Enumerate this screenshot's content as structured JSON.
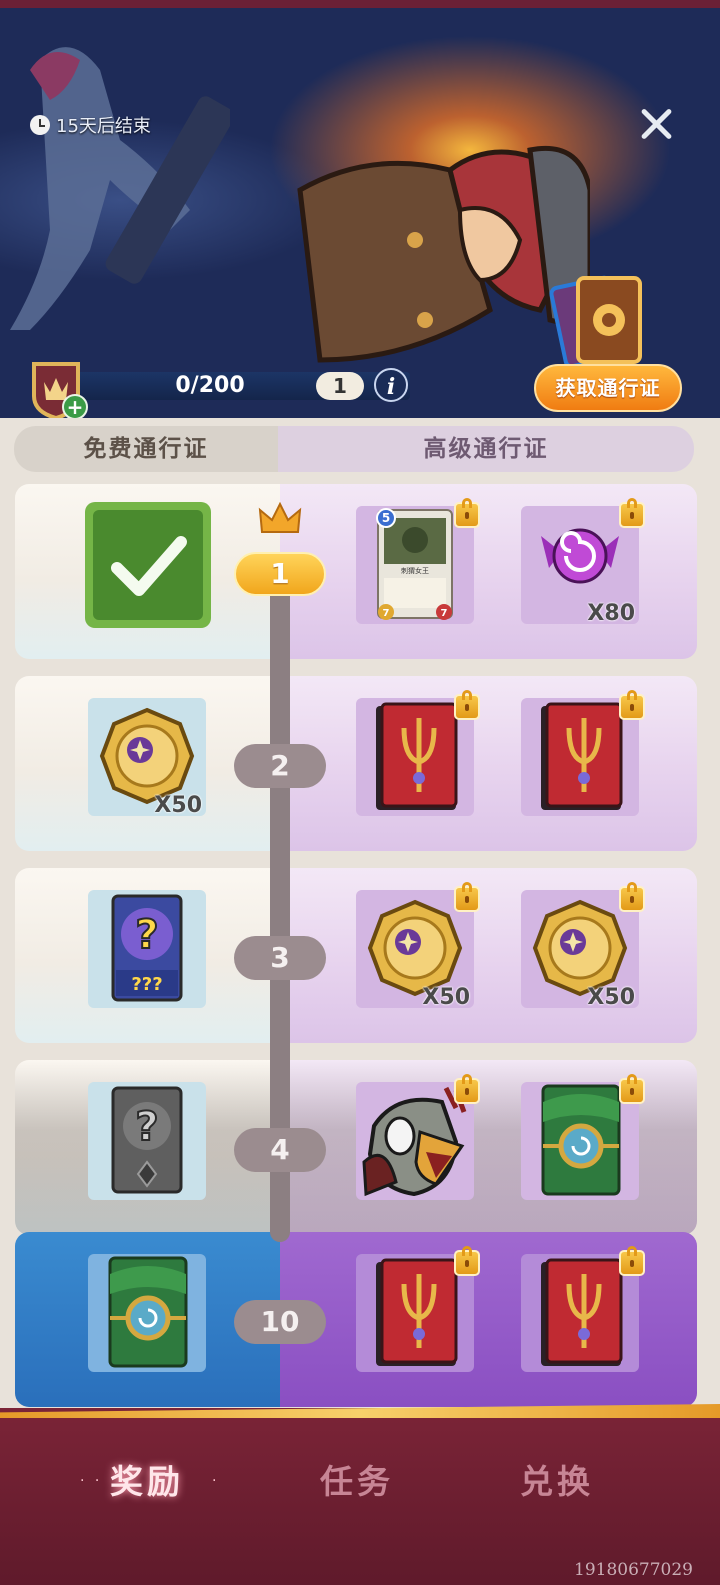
{
  "banner": {
    "timer_text": "15天后结束",
    "progress_text": "0/200",
    "level": "1",
    "info_label": "i",
    "plus_label": "+",
    "get_pass_label": "获取通行证"
  },
  "tabs": {
    "free": "免费通行证",
    "premium": "高级通行证"
  },
  "rows": [
    {
      "level": "1",
      "free_qty": "",
      "prem1_qty": "",
      "prem2_qty": "X80",
      "prem_card_name": "刺猬女王",
      "prem_card_cost": "5",
      "prem_card_atk": "7",
      "prem_card_hp": "7"
    },
    {
      "level": "2",
      "free_qty": "X50",
      "prem1_qty": "",
      "prem2_qty": ""
    },
    {
      "level": "3",
      "free_qty": "",
      "free_card_text": "???",
      "prem1_qty": "X50",
      "prem2_qty": "X50"
    },
    {
      "level": "4",
      "free_qty": "",
      "prem1_qty": "",
      "prem2_qty": ""
    },
    {
      "level": "10",
      "free_qty": "",
      "prem1_qty": "",
      "prem2_qty": ""
    }
  ],
  "nav": {
    "rewards": "奖励",
    "tasks": "任务",
    "exchange": "兑换",
    "dots_left": "· ·",
    "dots_right": "·"
  },
  "watermark": "19180677029",
  "colors": {
    "accent_orange": "#f07c12",
    "nav_bg": "#6b2036",
    "level_active": "#f1a61c"
  }
}
